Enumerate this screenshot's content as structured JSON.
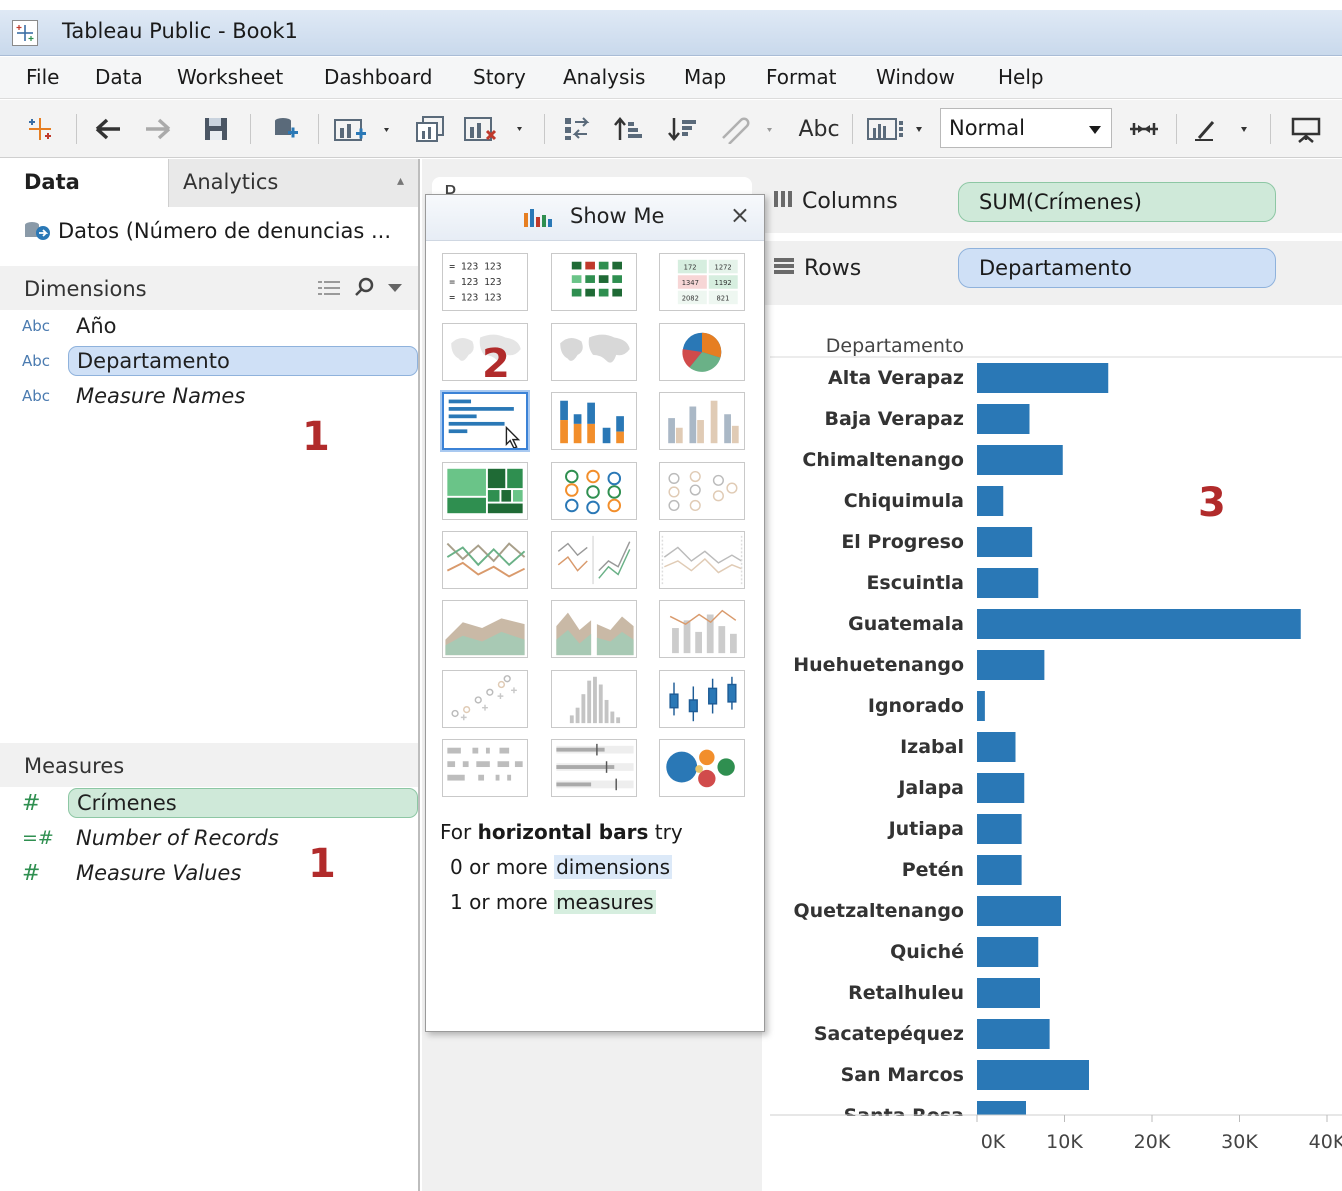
{
  "window": {
    "title": "Tableau Public - Book1"
  },
  "menu": [
    "File",
    "Data",
    "Worksheet",
    "Dashboard",
    "Story",
    "Analysis",
    "Map",
    "Format",
    "Window",
    "Help"
  ],
  "toolbar": {
    "abc_label": "Abc",
    "fit_value": "Normal"
  },
  "left_pane": {
    "tabs": {
      "data": "Data",
      "analytics": "Analytics"
    },
    "datasource": "Datos (Número de denuncias ...",
    "dimensions_header": "Dimensions",
    "dimensions": [
      {
        "type": "Abc",
        "name": "Año"
      },
      {
        "type": "Abc",
        "name": "Departamento"
      },
      {
        "type": "Abc",
        "name": "Measure Names"
      }
    ],
    "measures_header": "Measures",
    "measures": [
      {
        "type": "#",
        "name": "Crímenes"
      },
      {
        "type": "=#",
        "name": "Number of Records"
      },
      {
        "type": "#",
        "name": "Measure Values"
      }
    ]
  },
  "annotations": [
    "1",
    "2",
    "3",
    "1"
  ],
  "shelves": {
    "columns_label": "Columns",
    "columns_pill": "SUM(Crímenes)",
    "rows_label": "Rows",
    "rows_pill": "Departamento",
    "marks_partial": "P"
  },
  "showme": {
    "title": "Show Me",
    "close": "×",
    "hint": {
      "prefix": "For",
      "chart_name": "horizontal bars",
      "suffix": "try",
      "dims_line": "0 or more",
      "dims_word": "dimensions",
      "meas_line": "1 or more",
      "meas_word": "measures"
    }
  },
  "colors": {
    "bar": "#2a78b6",
    "accent_red": "#b12b2b",
    "dim_pill": "#cfe0f6",
    "meas_pill": "#cfe9d9"
  },
  "chart_data": {
    "type": "bar",
    "orientation": "horizontal",
    "header": "Departamento",
    "categories": [
      "Alta Verapaz",
      "Baja Verapaz",
      "Chimaltenango",
      "Chiquimula",
      "El Progreso",
      "Escuintla",
      "Guatemala",
      "Huehuetenango",
      "Ignorado",
      "Izabal",
      "Jalapa",
      "Jutiapa",
      "Petén",
      "Quetzaltenango",
      "Quiché",
      "Retalhuleu",
      "Sacatepéquez",
      "San Marcos",
      "Santa Rosa"
    ],
    "values": [
      15000,
      6000,
      9800,
      3000,
      6300,
      7000,
      37000,
      7700,
      900,
      4400,
      5400,
      5100,
      5100,
      9600,
      7000,
      7200,
      8300,
      12800,
      5600
    ],
    "xticks": [
      "0K",
      "10K",
      "20K",
      "30K",
      "40K"
    ],
    "xlim": [
      0,
      40000
    ]
  }
}
